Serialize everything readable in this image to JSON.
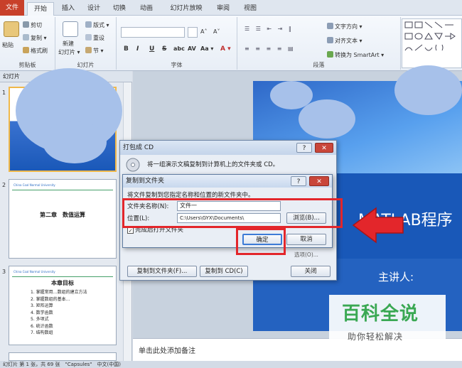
{
  "tabs": [
    "文件",
    "开始",
    "插入",
    "设计",
    "切换",
    "动画",
    "幻灯片放映",
    "审阅",
    "视图"
  ],
  "ribbon": {
    "clipboard": {
      "paste": "粘贴",
      "cut": "剪切",
      "copy": "复制 ▾",
      "format_painter": "格式刷",
      "label": "剪贴板"
    },
    "slides": {
      "new_slide": "新建",
      "new_slide2": "幻灯片 ▾",
      "layout": "版式 ▾",
      "reset": "重设",
      "section": "节 ▾",
      "label": "幻灯片"
    },
    "font": {
      "grow": "A˄",
      "shrink": "A˅",
      "bold": "B",
      "italic": "I",
      "underline": "U",
      "strike": "S",
      "shadow": "abc",
      "spacing": "AV",
      "case": "Aa ▾",
      "color": "A ▾",
      "label": "字体"
    },
    "paragraph": {
      "text_direction": "文字方向 ▾",
      "align_text": "对齐文本 ▾",
      "smartart": "转换为 SmartArt ▾",
      "label": "段落"
    }
  },
  "panel": {
    "header": "幻灯片",
    "slide2_title": "第二章　数值运算",
    "slide3_title": "本章目标",
    "logo_text": "China Coal Normal University"
  },
  "slide3_items": [
    "1. 掌握常用…数组的建立方法",
    "2. 掌握数组的基本…",
    "3. 矩阵运算",
    "4. 数学函数",
    "5. 多项式",
    "6. 统计函数",
    "7. 结构数组"
  ],
  "main_slide": {
    "title_text": "MATLAB程序",
    "speaker": "主讲人:"
  },
  "notes": "单击此处添加备注",
  "status": "幻灯片 第 1 张，共 69 张　\"Capsules\"　中文(中国)",
  "dialog_cd": {
    "title": "打包成 CD",
    "help": "?",
    "close": "✕",
    "desc": "将一组演示文稿复制到计算机上的文件夹或 CD。",
    "copy_to_folder": "复制到文件夹(F)...",
    "copy_to_cd": "复制到 CD(C)",
    "close_btn": "关闭",
    "options_hint": "选项(O)..."
  },
  "dialog_folder": {
    "title": "复制到文件夹",
    "help": "?",
    "close": "✕",
    "hint": "将文件复制到您指定名称和位置的新文件夹中。",
    "name_label": "文件夹名称(N):",
    "name_value": "文件一",
    "location_label": "位置(L):",
    "location_value": "C:\\Users\\GYX\\Documents\\",
    "browse": "浏览(B)...",
    "open_when_done": "完成后打开文件夹",
    "ok": "确定",
    "cancel": "取消"
  },
  "watermark": {
    "title": "百科全说",
    "subtitle": "助你轻松解决"
  }
}
